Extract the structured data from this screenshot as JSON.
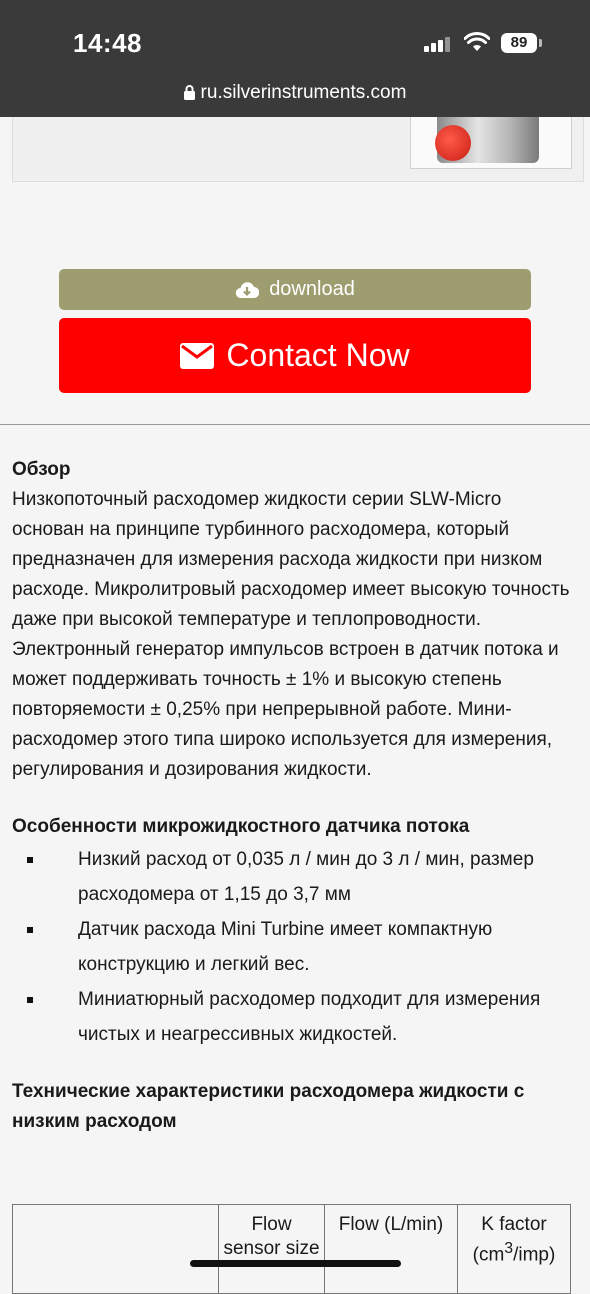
{
  "status_bar": {
    "time": "14:48",
    "battery": "89"
  },
  "browser": {
    "url": "ru.silverinstruments.com"
  },
  "buttons": {
    "download": "download",
    "contact": "Contact Now"
  },
  "overview": {
    "title": "Обзор",
    "body": "Низкопоточный расходомер жидкости серии SLW-Micro основан на принципе турбинного расходомера, который предназначен для измерения расхода жидкости при низком расходе. Микролитровый расходомер имеет высокую точность даже при высокой температуре и теплопроводности. Электронный генератор импульсов встроен в датчик потока и может поддерживать точность ± 1% и высокую степень повторяемости ± 0,25% при непрерывной работе. Мини-расходомер этого типа широко используется для измерения, регулирования и дозирования жидкости."
  },
  "features": {
    "title": "Особенности микрожидкостного датчика потока",
    "items": [
      "Низкий расход от 0,035 л / мин до 3 л / мин, размер расходомера от 1,15 до 3,7 мм",
      "Датчик расхода Mini Turbine имеет компактную конструкцию и легкий вес.",
      "Миниатюрный расходомер подходит для измерения чистых и неагрессивных жидкостей."
    ]
  },
  "specs": {
    "title": "Технические характеристики расходомера жидкости с низким расходом",
    "headers": [
      "",
      "Flow sensor size",
      "Flow (L/min)",
      "K factor (cm",
      "3",
      "/imp)"
    ]
  },
  "colors": {
    "download": "#9d9d6f",
    "contact": "#ff0000",
    "topbar": "#3a3a3a"
  }
}
